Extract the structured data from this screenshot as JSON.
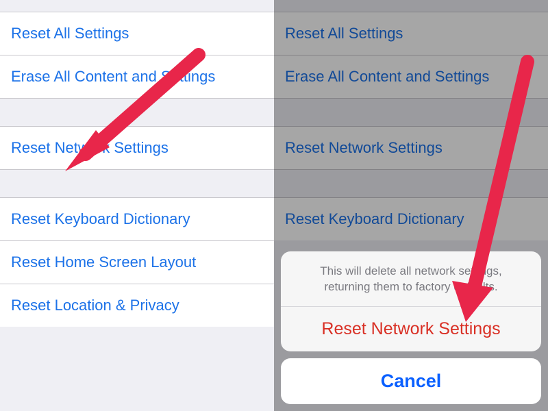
{
  "left": {
    "items": [
      "Reset All Settings",
      "Erase All Content and Settings",
      "Reset Network Settings",
      "Reset Keyboard Dictionary",
      "Reset Home Screen Layout",
      "Reset Location & Privacy"
    ]
  },
  "right": {
    "items": [
      "Reset All Settings",
      "Erase All Content and Settings",
      "Reset Network Settings",
      "Reset Keyboard Dictionary"
    ],
    "sheet": {
      "message": "This will delete all network settings, returning them to factory defaults.",
      "action": "Reset Network Settings",
      "cancel": "Cancel"
    }
  },
  "colors": {
    "arrow": "#e8264a"
  }
}
